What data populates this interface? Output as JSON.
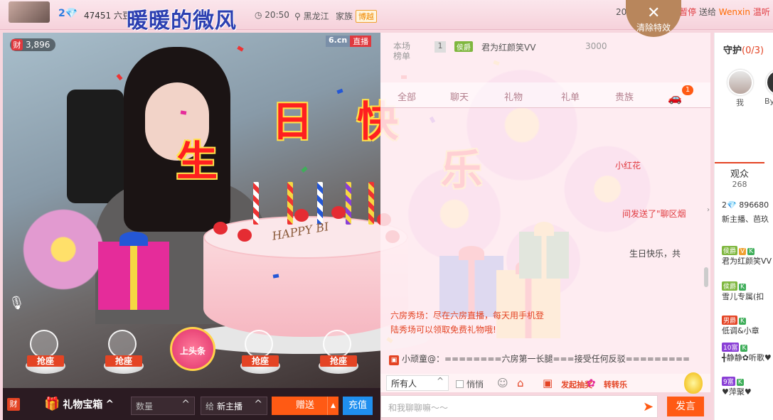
{
  "topbar": {
    "level": "2💎",
    "fans": "47451 六豆",
    "anchor_name": "暖暖的微风",
    "time": "20:50",
    "location": "黑龙江",
    "family_label": "家族",
    "family_badge": "博越",
    "notice_prefix": "20",
    "notice_pause": "暂停",
    "notice_sent": "送给",
    "notice_user": "Wenxin",
    "notice_end": "温听"
  },
  "clear_effects": {
    "label": "清除特效"
  },
  "video": {
    "wealth_tag": "财",
    "wealth_count": "3,896",
    "brand_site": "6.cn",
    "brand_live": "直播",
    "overlay_chars": [
      "生",
      "日",
      "快",
      "乐"
    ],
    "cake_text": "HAPPY BI"
  },
  "seats": [
    {
      "label": "抢座"
    },
    {
      "label": "抢座"
    },
    {
      "label": "上头条"
    },
    {
      "label": "抢座"
    },
    {
      "label": "抢座"
    }
  ],
  "bottombar": {
    "cai": "财",
    "giftbox_label": "礼物宝箱",
    "qty_placeholder": "数量",
    "to_label": "给",
    "recipient": "新主播",
    "send_label": "赠送",
    "recharge_label": "充值"
  },
  "rank": {
    "label": "本场榜单",
    "position": "1",
    "badge": "侯爵",
    "user": "君为红颜笑VV",
    "points": "3000"
  },
  "tabs": [
    "全部",
    "聊天",
    "礼物",
    "礼单",
    "贵族"
  ],
  "car_badge": "1",
  "messages": [
    {
      "text": "小红花",
      "cls": "red"
    },
    {
      "text": "间发送了\"聊区烟",
      "cls": "red"
    },
    {
      "text": "生日快乐，共",
      "cls": "dark"
    }
  ],
  "promo": {
    "line1": "六房秀场：尽在六房直播，每天用手机登",
    "line2": "陆秀场可以领取免费礼物哦!"
  },
  "system_message": "小顽童@：========六房第一长腿===接受任何反驳=========",
  "chat_tools": {
    "audience": "所有人",
    "whisper": "悄悄",
    "lottery": "发起抽奖",
    "spin": "转转乐"
  },
  "chat_input": {
    "placeholder": "和我聊聊嘛～～"
  },
  "post_label": "发言",
  "guard": {
    "title": "守护",
    "count": "(0/3)",
    "users": [
      {
        "name": "我"
      },
      {
        "name": "By"
      }
    ]
  },
  "audience": {
    "tab_label": "观众",
    "count": "268",
    "rows": [
      {
        "text": "2💎 896680",
        "badges": []
      },
      {
        "text": "新主播、芭玖",
        "badges": []
      },
      {
        "text": "君为红颜笑VV",
        "badges": [
          {
            "t": "侯爵",
            "c": "#7fb73f"
          },
          {
            "t": "V",
            "c": "#f0a030"
          },
          {
            "t": "K",
            "c": "#3fae5a"
          }
        ]
      },
      {
        "text": "雪儿专属(扣",
        "badges": [
          {
            "t": "侯爵",
            "c": "#7fb73f"
          },
          {
            "t": "K",
            "c": "#3fae5a"
          }
        ]
      },
      {
        "text": "低调&小章",
        "badges": [
          {
            "t": "男爵",
            "c": "#e44424"
          },
          {
            "t": "K",
            "c": "#3fae5a"
          }
        ]
      },
      {
        "text": "╉静静✿听歌♥",
        "badges": [
          {
            "t": "10富",
            "c": "#8a3fd6"
          },
          {
            "t": "K",
            "c": "#3fae5a"
          }
        ]
      },
      {
        "text": "♥萍聚♥",
        "badges": [
          {
            "t": "9富",
            "c": "#8a3fd6"
          },
          {
            "t": "K",
            "c": "#3fae5a"
          }
        ]
      }
    ]
  }
}
